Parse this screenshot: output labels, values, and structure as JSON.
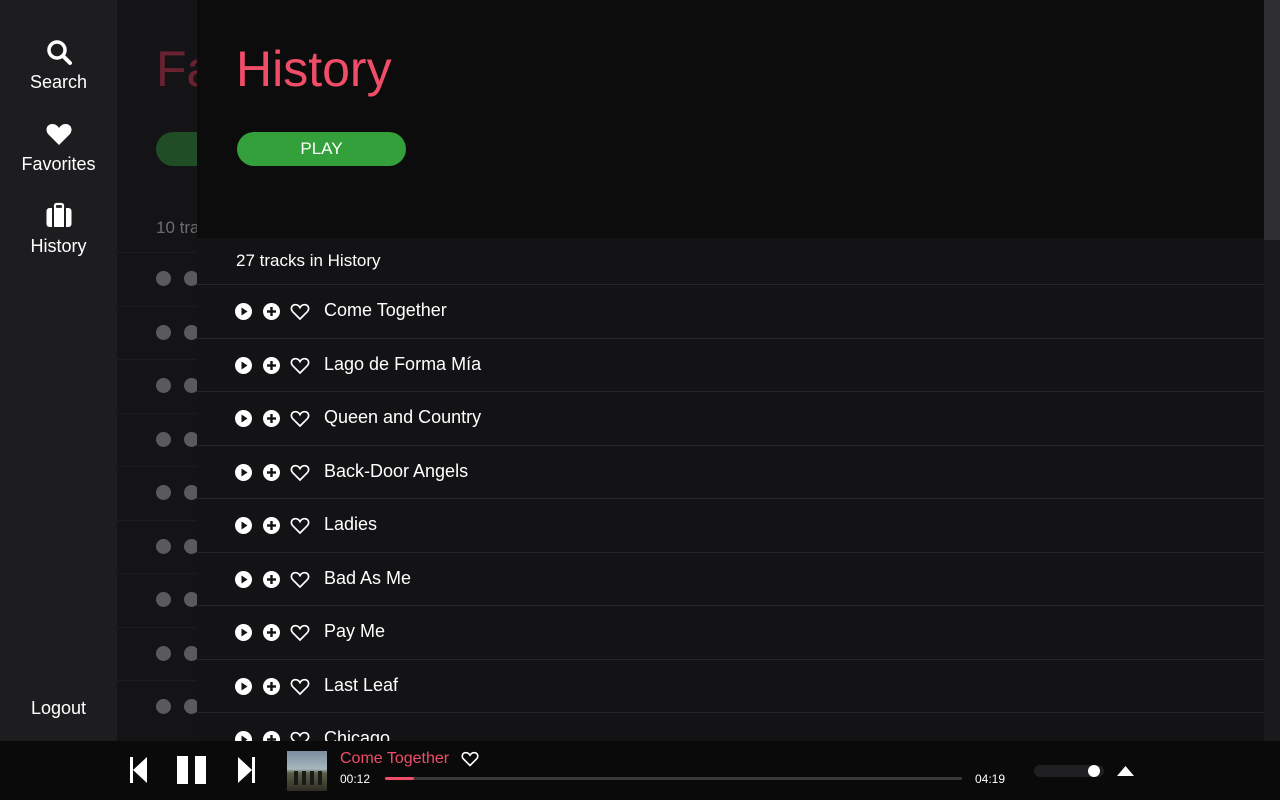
{
  "sidebar": {
    "items": [
      {
        "label": "Search",
        "icon": "search-icon"
      },
      {
        "label": "Favorites",
        "icon": "heart-icon"
      },
      {
        "label": "History",
        "icon": "briefcase-icon"
      }
    ],
    "logout_label": "Logout"
  },
  "background_page": {
    "title": "Fa",
    "count_text": "10 tra"
  },
  "history": {
    "title": "History",
    "play_label": "PLAY",
    "count_text": "27 tracks in History",
    "tracks": [
      "Come Together",
      "Lago de Forma Mía",
      "Queen and Country",
      "Back-Door Angels",
      "Ladies",
      "Bad As Me",
      "Pay Me",
      "Last Leaf",
      "Chicago"
    ]
  },
  "player": {
    "track_title": "Come Together",
    "current_time": "00:12",
    "duration": "04:19",
    "progress_fraction": 0.05,
    "volume_fraction": 0.85
  },
  "colors": {
    "accent": "#ef4d68",
    "play_button": "#34a03c",
    "sidebar_bg": "#1d1d1f",
    "panel_bg": "#0c0c0d"
  }
}
